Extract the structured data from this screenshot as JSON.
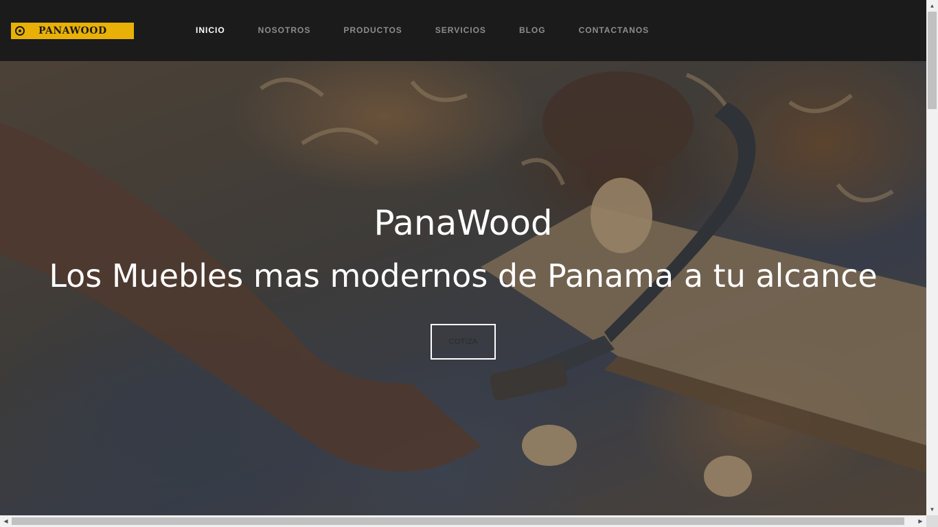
{
  "header": {
    "logo_text": "PANAWOOD",
    "logo_icon": "gear-emblem-icon",
    "brand_color": "#e9b107"
  },
  "nav": {
    "items": [
      {
        "label": "INICIO",
        "active": true
      },
      {
        "label": "NOSOTROS",
        "active": false
      },
      {
        "label": "PRODUCTOS",
        "active": false
      },
      {
        "label": "SERVICIOS",
        "active": false
      },
      {
        "label": "BLOG",
        "active": false
      },
      {
        "label": "CONTACTANOS",
        "active": false
      }
    ]
  },
  "hero": {
    "title": "PanaWood",
    "subtitle": "Los Muebles mas modernos de Panama a tu alcance",
    "cta_label": "COTIZA",
    "background_image": "woodworker-with-drawknife"
  },
  "scrollbars": {
    "up_arrow": "▲",
    "down_arrow": "▼",
    "left_arrow": "◀",
    "right_arrow": "▶"
  }
}
